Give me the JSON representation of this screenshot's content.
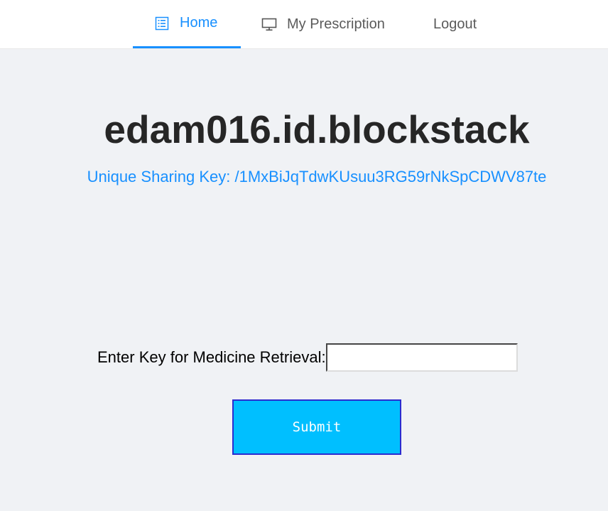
{
  "nav": {
    "items": [
      {
        "label": "Home",
        "icon": "list-icon",
        "active": true
      },
      {
        "label": "My Prescription",
        "icon": "desktop-icon",
        "active": false
      },
      {
        "label": "Logout",
        "icon": "",
        "active": false
      }
    ]
  },
  "main": {
    "title": "edam016.id.blockstack",
    "sharing_key_text": "Unique Sharing Key: /1MxBiJqTdwKUsuu3RG59rNkSpCDWV87te"
  },
  "form": {
    "label": "Enter Key for Medicine Retrieval:",
    "input_value": "",
    "submit_label": "Submit"
  },
  "colors": {
    "accent": "#1890ff",
    "submit_bg": "#00bfff",
    "submit_border": "#2c2ccf",
    "background": "#f0f2f5"
  }
}
